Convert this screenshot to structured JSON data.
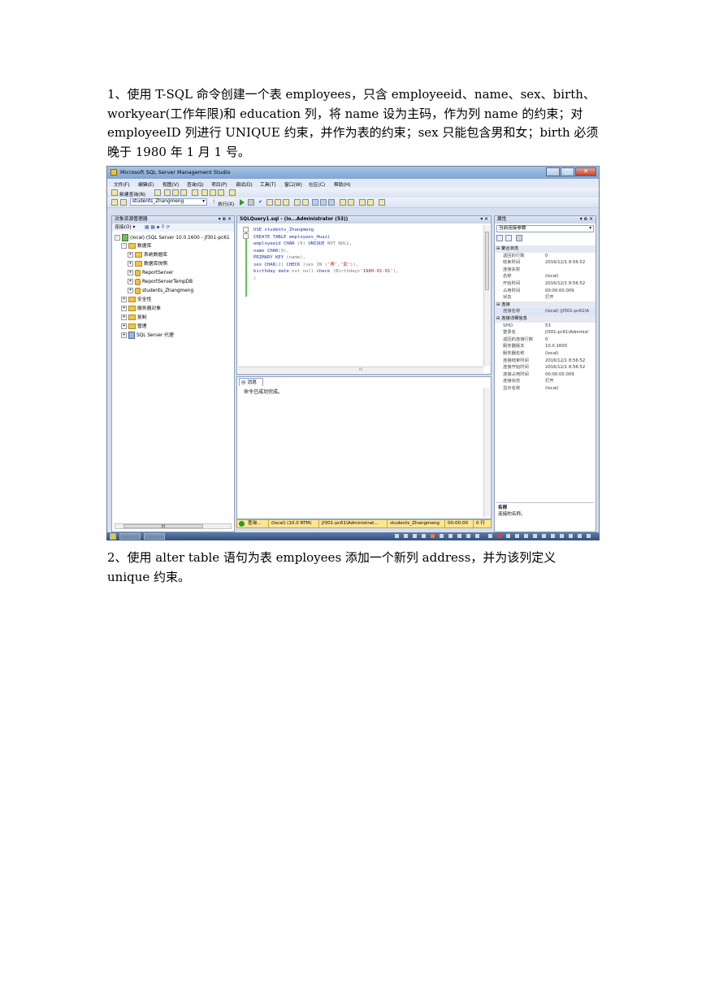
{
  "doc": {
    "para1": "1、使用 T-SQL 命令创建一个表 employees，只含 employeeid、name、sex、birth、workyear(工作年限)和 education 列，将 name 设为主码，作为列 name 的约束；对 employeeID 列进行 UNIQUE 约束，并作为表的约束；sex 只能包含男和女；birth 必须晚于 1980 年 1 月 1 号。",
    "para2": "2、使用 alter table 语句为表 employees 添加一个新列 address，并为该列定义 unique 约束。"
  },
  "window": {
    "title": "Microsoft SQL Server Management Studio",
    "min": "–",
    "max": "□",
    "close": "✕"
  },
  "menu": [
    "文件(F)",
    "编辑(E)",
    "视图(V)",
    "查询(Q)",
    "项目(P)",
    "调试(D)",
    "工具(T)",
    "窗口(W)",
    "社区(C)",
    "帮助(H)"
  ],
  "toolbar": {
    "new_query": "新建查询(N)",
    "database": "students_Zhangmeng",
    "execute": "执行(X)"
  },
  "object_explorer": {
    "title": "对象资源管理器",
    "pin": "▾ ⊕ ✕",
    "connect": "连接(O) ▾",
    "server": "(local) (SQL Server 10.0.1600 - jf301-pc61",
    "databases": "数据库",
    "system_databases": "系统数据库",
    "snapshots": "数据库快照",
    "report_server": "ReportServer",
    "report_temp": "ReportServerTempDB",
    "students": "students_Zhangmeng",
    "security": "安全性",
    "server_objects": "服务器对象",
    "replication": "复制",
    "management": "管理",
    "agent": "SQL Server 代理",
    "scroll": "III"
  },
  "editor": {
    "tab": "SQLQuery1.sql - (lo...Administrator (53))",
    "tab_ctl": "▾ ✕",
    "line1_kw": "USE",
    "line1_rest": " students_Zhangmeng",
    "line2_kw": "CREATE TABLE",
    "line2_rest": " employees_Huai(",
    "line3_a": "employeeid ",
    "line3_b": "CHAR",
    "line3_c": " (6) ",
    "line3_d": "UNIQUE",
    "line3_e": " NOT NULL",
    "line3_f": ",",
    "line4_a": "name ",
    "line4_b": "CHAR",
    "line4_c": "(9),",
    "line5_a": "PRIMARY KEY",
    "line5_b": " (name),",
    "line6_a": "sex ",
    "line6_b": "CHAR",
    "line6_c": "(2) ",
    "line6_d": "CHECK",
    "line6_e": " (sex ",
    "line6_f": "IN",
    "line6_g": " (",
    "line6_h": "'男'",
    "line6_i": ",",
    "line6_j": "'女'",
    "line6_k": ")),",
    "line7_a": "birthday ",
    "line7_b": "date",
    "line7_c": " not null ",
    "line7_d": "check",
    "line7_e": " (Birthday>",
    "line7_f": "'1980-01-01'",
    "line7_g": "),",
    "line8": ")",
    "collapse": "⊟",
    "hscroll": "III"
  },
  "messages": {
    "tab": "消息",
    "text": "命令已成功完成。"
  },
  "status": {
    "query": "查询...",
    "server": "(local) (10.0 RTM)",
    "user": "jf301-pc61\\Administrat...",
    "db": "students_Zhangmeng",
    "time": "00:00:00",
    "rows": "0 行"
  },
  "properties": {
    "title": "属性",
    "ctl": "▾ ⊕ ✕",
    "combo": "当前连接参数",
    "rows": [
      {
        "k": "⊟ 聚合状态",
        "v": "",
        "cat": true
      },
      {
        "k": "返回的行数",
        "v": "0"
      },
      {
        "k": "结束时间",
        "v": "2016/12/1 8:56:52"
      },
      {
        "k": "连接失败",
        "v": ""
      },
      {
        "k": "名称",
        "v": "(local)"
      },
      {
        "k": "开始时间",
        "v": "2016/12/1 8:56:52"
      },
      {
        "k": "占用时间",
        "v": "00:00:00.009"
      },
      {
        "k": "状态",
        "v": "打开"
      },
      {
        "k": "⊟ 连接",
        "v": "",
        "cat": true
      },
      {
        "k": "连接名称",
        "v": "(local) (jf301-pc61\\A",
        "sel": true
      },
      {
        "k": "⊟ 连接详细信息",
        "v": "",
        "cat": true
      },
      {
        "k": "SPID",
        "v": "53"
      },
      {
        "k": "登录名",
        "v": "jf301-pc61\\Administ"
      },
      {
        "k": "返回的连接行数",
        "v": "0"
      },
      {
        "k": "服务器版本",
        "v": "10.0.1600"
      },
      {
        "k": "服务器名称",
        "v": "(local)"
      },
      {
        "k": "连接结束时间",
        "v": "2016/12/1 8:56:52"
      },
      {
        "k": "连接开始时间",
        "v": "2016/12/1 8:56:52"
      },
      {
        "k": "连接占用时间",
        "v": "00:00:00.009"
      },
      {
        "k": "连接状态",
        "v": "打开"
      },
      {
        "k": "显示名称",
        "v": "(local)"
      }
    ],
    "desc_title": "名称",
    "desc_text": "连接的名称。"
  }
}
